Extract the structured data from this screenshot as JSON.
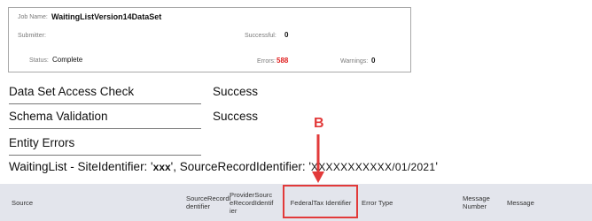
{
  "summary": {
    "job_name_label": "Job Name:",
    "job_name_value": "WaitingListVersion14DataSet",
    "submitter_label": "Submitter:",
    "submitter_value": "",
    "successful_label": "Successful:",
    "successful_value": "0",
    "status_label": "Status:",
    "status_value": "Complete",
    "errors_label": "Errors:",
    "errors_value": "588",
    "warnings_label": "Warnings:",
    "warnings_value": "0",
    "errors_color": "#e02020"
  },
  "checks": [
    {
      "label": "Data Set Access Check",
      "status": "Success"
    },
    {
      "label": "Schema Validation",
      "status": "Success"
    }
  ],
  "entity_errors_heading": "Entity Errors",
  "identifier": {
    "prefix": "WaitingList - SiteIdentifier: '",
    "site_identifier": "xxx",
    "middle": "', SourceRecordIdentifier: '",
    "source_record_identifier": "XXXXXXXXXXX/01/2021",
    "suffix": "'"
  },
  "annotation": {
    "marker_label": "B",
    "color": "#e23a3a",
    "highlighted_column": "FederalTax Identifier"
  },
  "table": {
    "columns": [
      "Source",
      "SourceRecordIdentifier",
      "ProviderSourceRecordIdentifier",
      "FederalTax Identifier",
      "Error Type",
      "Message Number",
      "Message"
    ],
    "column_display": [
      "Source",
      "SourceRecordI dentifier",
      "ProviderSourc eRecordIdentif ier",
      "FederalTax Identifier",
      "Error Type",
      "Message Number",
      "Message"
    ]
  }
}
